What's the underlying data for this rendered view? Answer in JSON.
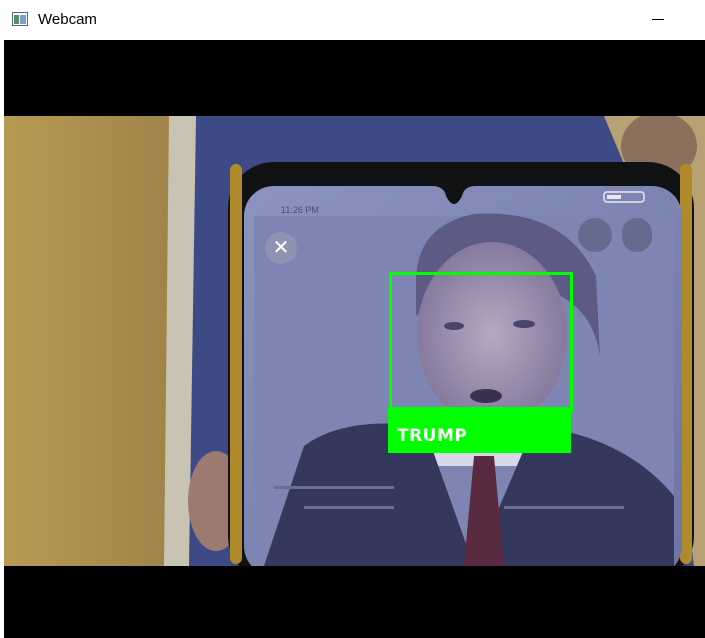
{
  "window": {
    "title": "Webcam",
    "icon": "app-window-icon",
    "minimize_icon": "minimize-icon"
  },
  "phone": {
    "status_time": "11:26 PM",
    "close_icon": "close-icon",
    "close_glyph": "✕",
    "lens_icon": "lens-icon",
    "more_icon": "more-vertical-icon"
  },
  "detection": {
    "label": "TRUMP",
    "box_color": "#00ff00",
    "label_color": "#ffffff"
  }
}
